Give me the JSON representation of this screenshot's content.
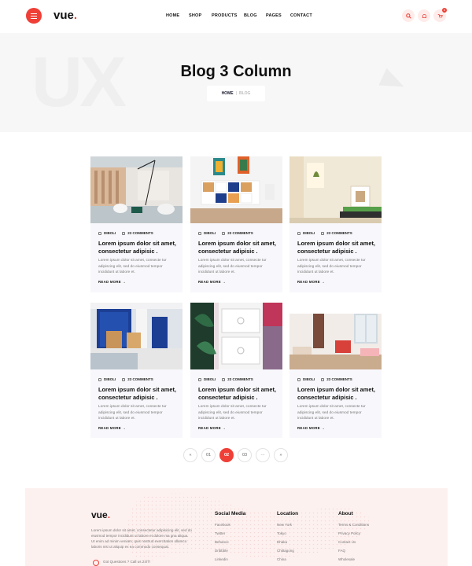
{
  "header": {
    "logo": "vue",
    "logo_dot": ".",
    "nav": [
      "HOME",
      "SHOP",
      "PRODUCTS",
      "BLOG",
      "PAGES",
      "CONTACT"
    ],
    "cart_count": "0",
    "icons": [
      "menu-icon",
      "search-icon",
      "user-icon",
      "cart-icon"
    ],
    "accent": "#ef3f36"
  },
  "hero": {
    "bg_text": "UX",
    "title": "Blog 3 Column",
    "breadcrumb": {
      "home": "HOME",
      "separator": "|",
      "current": "BLOG"
    }
  },
  "posts": [
    {
      "author": "DIBOLI",
      "comments": "23 COMMENTS",
      "title": "Lorem ipsum dolor sit amet, consectetur adipisic .",
      "excerpt": "Lorem ipsum dolor sit amet, consecte tur adipiscing elit, sed do eiusmod tempor incididunt ut labore et.",
      "more": "READ MORE"
    },
    {
      "author": "DIBOLI",
      "comments": "23 COMMENTS",
      "title": "Lorem ipsum dolor sit amet, consectetur adipisic .",
      "excerpt": "Lorem ipsum dolor sit amet, consecte tur adipiscing elit, sed do eiusmod tempor incididunt ut labore et.",
      "more": "READ MORE"
    },
    {
      "author": "DIBOLI",
      "comments": "23 COMMENTS",
      "title": "Lorem ipsum dolor sit amet, consectetur adipisic .",
      "excerpt": "Lorem ipsum dolor sit amet, consecte tur adipiscing elit, sed do eiusmod tempor incididunt ut labore et.",
      "more": "READ MORE"
    },
    {
      "author": "DIBOLI",
      "comments": "23 COMMENTS",
      "title": "Lorem ipsum dolor sit amet, consectetur adipisic .",
      "excerpt": "Lorem ipsum dolor sit amet, consecte tur adipiscing elit, sed do eiusmod tempor incididunt ut labore et.",
      "more": "READ MORE"
    },
    {
      "author": "DIBOLI",
      "comments": "23 COMMENTS",
      "title": "Lorem ipsum dolor sit amet, consectetur adipisic .",
      "excerpt": "Lorem ipsum dolor sit amet, consecte tur adipiscing elit, sed do eiusmod tempor incididunt ut labore et.",
      "more": "READ MORE"
    },
    {
      "author": "DIBOLI",
      "comments": "23 COMMENTS",
      "title": "Lorem ipsum dolor sit amet, consectetur adipisic .",
      "excerpt": "Lorem ipsum dolor sit amet, consecte tur adipiscing elit, sed do eiusmod tempor incididunt ut labore et.",
      "more": "READ MORE"
    }
  ],
  "pagination": {
    "prev": "«",
    "pages": [
      "01",
      "02",
      "03"
    ],
    "active": "02",
    "ellipsis": "···",
    "next": "»"
  },
  "footer": {
    "logo": "vue",
    "logo_dot": ".",
    "about": "Lorem ipsum dolor sit amet, consectetur adipisicing elit, sed do eiusmod tempor incididunt ut labore et dolore ma gna aliqua. Ut enim ad minim veniam, quis nostrud exercitation ullamco laboris nisi ut aliquip ex ea commodo consequat.",
    "call": "Got Questions ? Call us 24/7!",
    "columns": [
      {
        "title": "Social Media",
        "links": [
          "Facebook",
          "Twitter",
          "Behance",
          "Dribbble",
          "Linkedin"
        ]
      },
      {
        "title": "Location",
        "links": [
          "New York",
          "Tokyo",
          "Dhaka",
          "Chittagong",
          "China"
        ]
      },
      {
        "title": "About",
        "links": [
          "Terms & Conditions",
          "Privacy Policy",
          "Contact Us",
          "FAQ",
          "Wholesale"
        ]
      }
    ]
  }
}
